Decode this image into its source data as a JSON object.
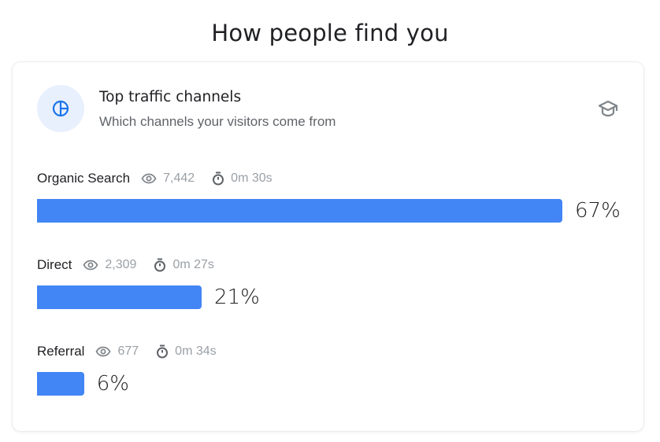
{
  "page": {
    "title": "How people find you"
  },
  "card": {
    "icon": "pie-chart-icon",
    "title": "Top traffic channels",
    "subtitle": "Which channels your visitors come from",
    "action_icon": "graduation-cap-icon"
  },
  "colors": {
    "bar": "#4285f4",
    "icon_bg": "#e8f0fe",
    "icon_fg": "#1a73e8",
    "meta_text": "#9aa0a6"
  },
  "channels": [
    {
      "name": "Organic Search",
      "views": "7,442",
      "avg_time": "0m 30s",
      "percent_label": "67%",
      "percent": 67
    },
    {
      "name": "Direct",
      "views": "2,309",
      "avg_time": "0m 27s",
      "percent_label": "21%",
      "percent": 21
    },
    {
      "name": "Referral",
      "views": "677",
      "avg_time": "0m 34s",
      "percent_label": "6%",
      "percent": 6
    }
  ]
}
